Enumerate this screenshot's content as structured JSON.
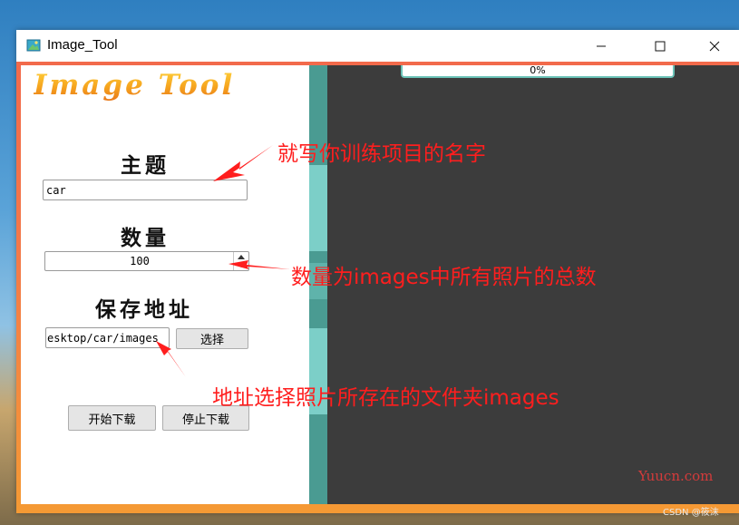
{
  "window": {
    "title": "Image_Tool"
  },
  "app": {
    "logo_text": "Image Tool",
    "topic": {
      "label": "主题",
      "value": "car"
    },
    "count": {
      "label": "数量",
      "value": "100"
    },
    "save_path": {
      "label": "保存地址",
      "value": "esktop/car/images",
      "browse_label": "选择"
    },
    "start_label": "开始下载",
    "stop_label": "停止下载",
    "progress": {
      "text": "0%",
      "value": 0
    }
  },
  "annotations": {
    "topic_note": "就写你训练项目的名字",
    "count_note": "数量为images中所有照片的总数",
    "path_note": "地址选择照片所存在的文件夹images"
  },
  "watermarks": {
    "site": "Yuucn.com",
    "csdn": "CSDN @筱沫"
  },
  "colors": {
    "frame_top": "#f26a4b",
    "frame_bottom": "#f59a34",
    "stripe": "#4a9b92",
    "progress_border": "#6bc2b7",
    "annotation": "#ff1e1e",
    "right_pane": "#3c3c3c"
  },
  "icons": {
    "app": "image-app-icon",
    "minimize": "minimize-icon",
    "maximize": "maximize-icon",
    "close": "close-icon",
    "spin": "spin-arrows-icon"
  }
}
